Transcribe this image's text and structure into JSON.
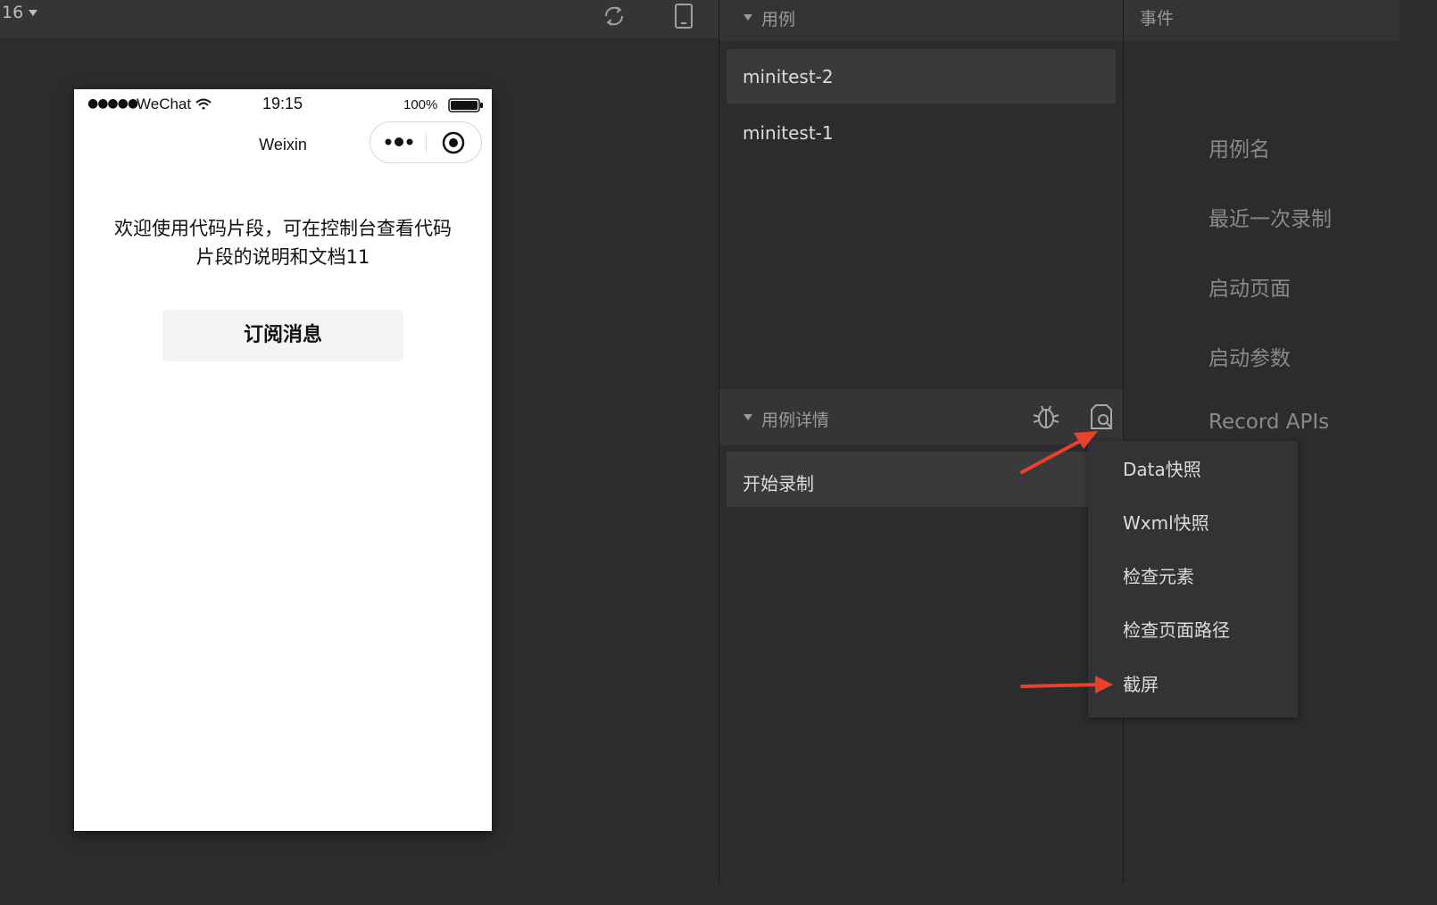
{
  "simulator": {
    "zoom_label": "16",
    "phone": {
      "signal": "●●●●●",
      "carrier": "WeChat",
      "time": "19:15",
      "battery_pct": "100%",
      "nav_title": "Weixin",
      "intro_text": "欢迎使用代码片段，可在控制台查看代码片段的说明和文档11",
      "subscribe_label": "订阅消息"
    }
  },
  "cases": {
    "section_title": "用例",
    "items": [
      "minitest-2",
      "minitest-1"
    ],
    "selected_index": 0
  },
  "detail": {
    "section_title": "用例详情",
    "record_label": "开始录制"
  },
  "events": {
    "section_title": "事件",
    "fields": [
      "用例名",
      "最近一次录制",
      "启动页面",
      "启动参数",
      "Record APIs"
    ]
  },
  "menu": {
    "items": [
      "Data快照",
      "Wxml快照",
      "检查元素",
      "检查页面路径",
      "截屏"
    ]
  },
  "colors": {
    "annotation_arrow": "#e8412c",
    "panel_bg": "#2c2c2e",
    "header_bg": "#343437"
  },
  "icons": [
    "rotate-icon",
    "device-icon",
    "wifi-icon",
    "battery-icon",
    "more-dots-icon",
    "close-target-icon",
    "bug-icon",
    "snapshot-icon"
  ]
}
